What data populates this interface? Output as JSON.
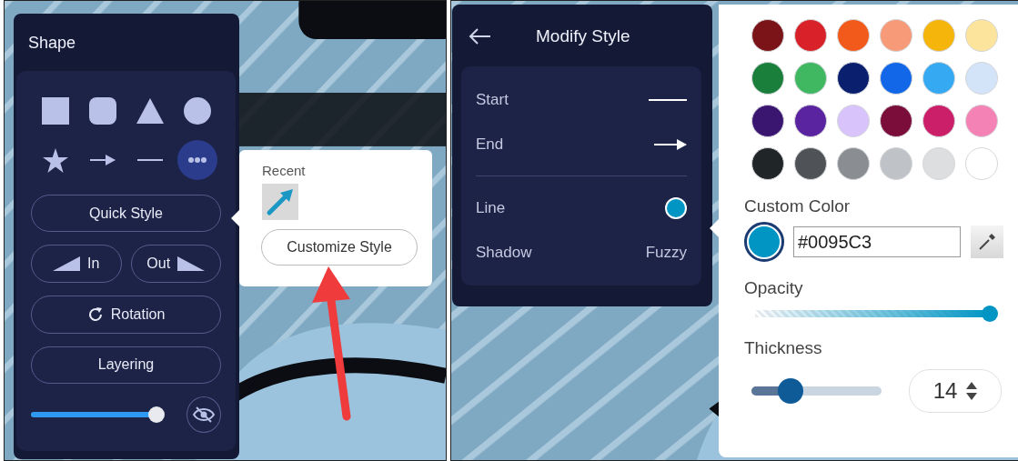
{
  "left_screen": {
    "shape_panel": {
      "title": "Shape",
      "shapes": [
        {
          "kind": "square",
          "selected": false
        },
        {
          "kind": "rounded",
          "selected": false
        },
        {
          "kind": "triangle",
          "selected": false
        },
        {
          "kind": "circle",
          "selected": false
        },
        {
          "kind": "star",
          "selected": false
        },
        {
          "kind": "arrow",
          "selected": false
        },
        {
          "kind": "line",
          "selected": false
        },
        {
          "kind": "more",
          "selected": true
        }
      ],
      "quick_style": "Quick Style",
      "in": "In",
      "out": "Out",
      "rotation": "Rotation",
      "layering": "Layering",
      "size_slider": {
        "level": 0.97
      }
    },
    "quick_style_popover": {
      "recent_label": "Recent",
      "customize_button": "Customize Style"
    }
  },
  "right_screen": {
    "modify_style": {
      "title": "Modify Style",
      "rows": [
        {
          "label": "Start",
          "kind": "line"
        },
        {
          "label": "End",
          "kind": "arrow"
        },
        {
          "label": "Line",
          "kind": "color",
          "color": "#0095c3"
        },
        {
          "label": "Shadow",
          "kind": "text",
          "value": "Fuzzy"
        }
      ]
    },
    "color_picker": {
      "swatches": [
        {
          "color": "#7b1418"
        },
        {
          "color": "#d9212a"
        },
        {
          "color": "#f25a1b"
        },
        {
          "color": "#f79a78"
        },
        {
          "color": "#f5b50a"
        },
        {
          "color": "#fce49c"
        },
        {
          "color": "#1a7f3a"
        },
        {
          "color": "#40b862"
        },
        {
          "color": "#0a1f6e"
        },
        {
          "color": "#1167e8"
        },
        {
          "color": "#35aaf2"
        },
        {
          "color": "#d3e3f8"
        },
        {
          "color": "#3a1670"
        },
        {
          "color": "#5a23a0"
        },
        {
          "color": "#d8c4fa"
        },
        {
          "color": "#7a0d3a"
        },
        {
          "color": "#cc1f6a"
        },
        {
          "color": "#f482b4"
        },
        {
          "color": "#202528"
        },
        {
          "color": "#4f5357"
        },
        {
          "color": "#8a8e93"
        },
        {
          "color": "#bfc3c7"
        },
        {
          "color": "#dcdee0"
        },
        {
          "color": "#ffffff"
        }
      ],
      "custom_color_label": "Custom Color",
      "custom_color": {
        "value": "#0095C3",
        "color": "#0095c3"
      },
      "opacity_label": "Opacity",
      "opacity": {
        "level": 1
      },
      "thickness_label": "Thickness",
      "thickness": {
        "level": 0.3,
        "value": "14"
      }
    }
  }
}
